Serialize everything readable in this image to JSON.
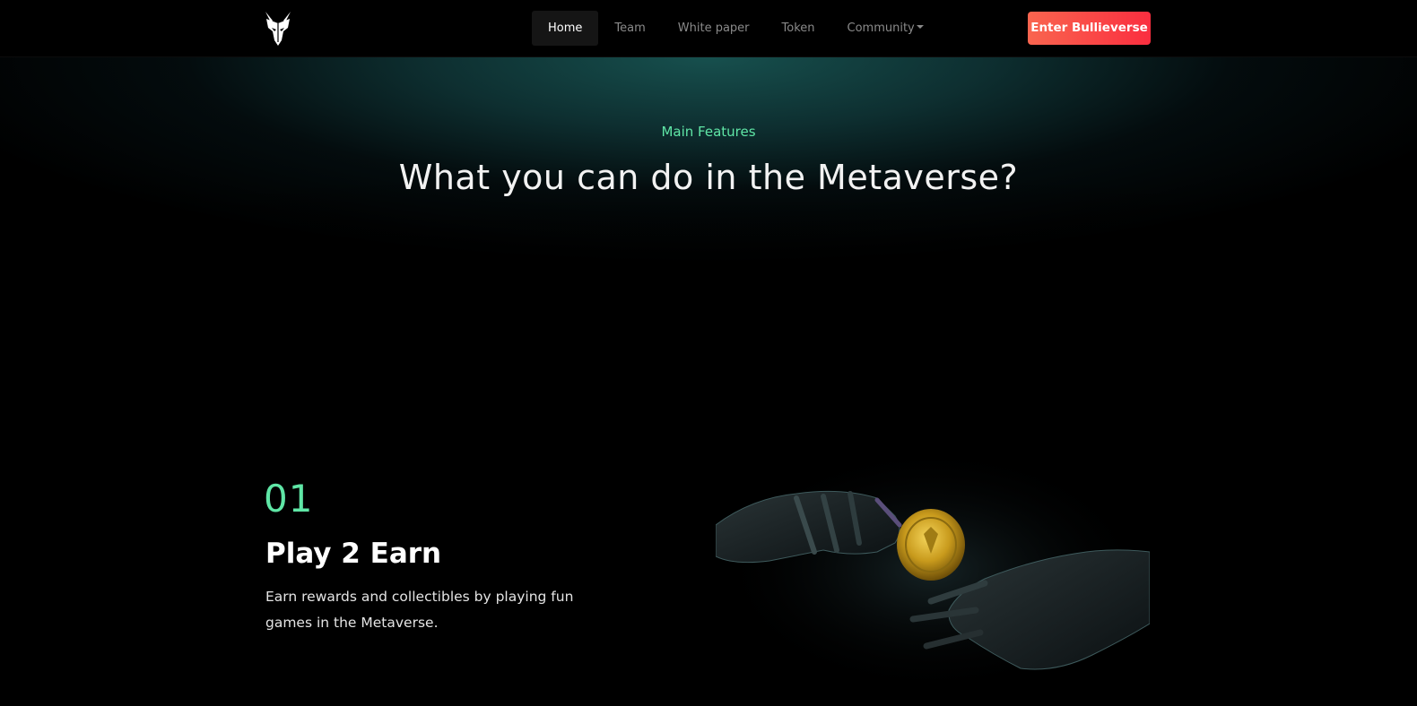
{
  "nav": {
    "logo_icon": "bull-head-icon",
    "links": [
      {
        "label": "Home",
        "active": true
      },
      {
        "label": "Team",
        "active": false
      },
      {
        "label": "White paper",
        "active": false
      },
      {
        "label": "Token",
        "active": false
      },
      {
        "label": "Community",
        "active": false,
        "dropdown": true
      }
    ],
    "cta_label": "Enter Bullieverse"
  },
  "hero": {
    "eyebrow": "Main Features",
    "headline": "What you can do in the Metaverse?"
  },
  "feature": {
    "number": "01",
    "title": "Play 2 Earn",
    "description": "Earn rewards and collectibles by playing fun games in the Metaverse.",
    "image_icon": "robot-hands-coin-image"
  },
  "colors": {
    "accent_green": "#5fe6a6",
    "cta_start": "#f9654f",
    "cta_end": "#fa2e3f",
    "background": "#000000"
  }
}
